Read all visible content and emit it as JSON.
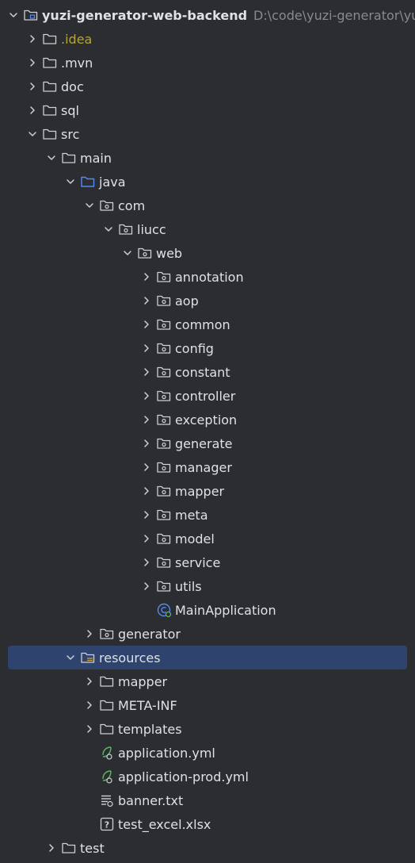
{
  "tree": [
    {
      "depth": 0,
      "expanded": true,
      "icon": "module-folder-icon",
      "label": "yuzi-generator-web-backend",
      "path": "D:\\code\\yuzi-generator\\yuzi-generator-web-backend",
      "style": "bold"
    },
    {
      "depth": 1,
      "expanded": false,
      "icon": "folder-icon",
      "label": ".idea",
      "style": "idea"
    },
    {
      "depth": 1,
      "expanded": false,
      "icon": "folder-icon",
      "label": ".mvn"
    },
    {
      "depth": 1,
      "expanded": false,
      "icon": "folder-icon",
      "label": "doc"
    },
    {
      "depth": 1,
      "expanded": false,
      "icon": "folder-icon",
      "label": "sql"
    },
    {
      "depth": 1,
      "expanded": true,
      "icon": "folder-icon",
      "label": "src"
    },
    {
      "depth": 2,
      "expanded": true,
      "icon": "folder-icon",
      "label": "main"
    },
    {
      "depth": 3,
      "expanded": true,
      "icon": "source-folder-icon",
      "label": "java"
    },
    {
      "depth": 4,
      "expanded": true,
      "icon": "package-icon",
      "label": "com"
    },
    {
      "depth": 5,
      "expanded": true,
      "icon": "package-icon",
      "label": "liucc"
    },
    {
      "depth": 6,
      "expanded": true,
      "icon": "package-icon",
      "label": "web"
    },
    {
      "depth": 7,
      "expanded": false,
      "icon": "package-icon",
      "label": "annotation"
    },
    {
      "depth": 7,
      "expanded": false,
      "icon": "package-icon",
      "label": "aop"
    },
    {
      "depth": 7,
      "expanded": false,
      "icon": "package-icon",
      "label": "common"
    },
    {
      "depth": 7,
      "expanded": false,
      "icon": "package-icon",
      "label": "config"
    },
    {
      "depth": 7,
      "expanded": false,
      "icon": "package-icon",
      "label": "constant"
    },
    {
      "depth": 7,
      "expanded": false,
      "icon": "package-icon",
      "label": "controller"
    },
    {
      "depth": 7,
      "expanded": false,
      "icon": "package-icon",
      "label": "exception"
    },
    {
      "depth": 7,
      "expanded": false,
      "icon": "package-icon",
      "label": "generate"
    },
    {
      "depth": 7,
      "expanded": false,
      "icon": "package-icon",
      "label": "manager"
    },
    {
      "depth": 7,
      "expanded": false,
      "icon": "package-icon",
      "label": "mapper"
    },
    {
      "depth": 7,
      "expanded": false,
      "icon": "package-icon",
      "label": "meta"
    },
    {
      "depth": 7,
      "expanded": false,
      "icon": "package-icon",
      "label": "model"
    },
    {
      "depth": 7,
      "expanded": false,
      "icon": "package-icon",
      "label": "service"
    },
    {
      "depth": 7,
      "expanded": false,
      "icon": "package-icon",
      "label": "utils"
    },
    {
      "depth": 7,
      "leaf": true,
      "icon": "spring-class-icon",
      "label": "MainApplication"
    },
    {
      "depth": 4,
      "expanded": false,
      "icon": "package-icon",
      "label": "generator"
    },
    {
      "depth": 3,
      "expanded": true,
      "icon": "resources-folder-icon",
      "label": "resources",
      "selected": true
    },
    {
      "depth": 4,
      "expanded": false,
      "icon": "folder-icon",
      "label": "mapper"
    },
    {
      "depth": 4,
      "expanded": false,
      "icon": "folder-icon",
      "label": "META-INF"
    },
    {
      "depth": 4,
      "expanded": false,
      "icon": "folder-icon",
      "label": "templates"
    },
    {
      "depth": 4,
      "leaf": true,
      "icon": "spring-yml-icon",
      "label": "application.yml"
    },
    {
      "depth": 4,
      "leaf": true,
      "icon": "spring-yml-icon",
      "label": "application-prod.yml"
    },
    {
      "depth": 4,
      "leaf": true,
      "icon": "text-file-icon",
      "label": "banner.txt"
    },
    {
      "depth": 4,
      "leaf": true,
      "icon": "unknown-file-icon",
      "label": "test_excel.xlsx"
    },
    {
      "depth": 2,
      "expanded": false,
      "icon": "folder-icon",
      "label": "test"
    }
  ],
  "colors": {
    "background": "#2b2d30",
    "selection": "#2e436e",
    "text": "#dfe1e5",
    "path_text": "#868a91",
    "idea_text": "#b5a43a",
    "icon_stroke": "#ced0d6",
    "source_folder": "#548af7",
    "spring_green": "#5fb865"
  }
}
